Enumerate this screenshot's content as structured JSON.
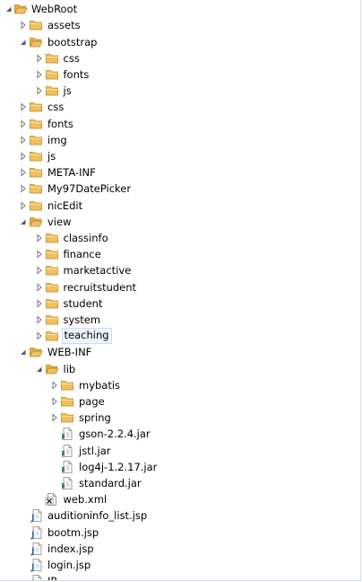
{
  "tree": [
    {
      "label": "WebRoot",
      "type": "folder",
      "depth": 0,
      "expanded": true
    },
    {
      "label": "assets",
      "type": "folder",
      "depth": 1,
      "expanded": false
    },
    {
      "label": "bootstrap",
      "type": "folder",
      "depth": 1,
      "expanded": true
    },
    {
      "label": "css",
      "type": "folder",
      "depth": 2,
      "expanded": false
    },
    {
      "label": "fonts",
      "type": "folder",
      "depth": 2,
      "expanded": false
    },
    {
      "label": "js",
      "type": "folder",
      "depth": 2,
      "expanded": false
    },
    {
      "label": "css",
      "type": "folder",
      "depth": 1,
      "expanded": false
    },
    {
      "label": "fonts",
      "type": "folder",
      "depth": 1,
      "expanded": false
    },
    {
      "label": "img",
      "type": "folder",
      "depth": 1,
      "expanded": false
    },
    {
      "label": "js",
      "type": "folder",
      "depth": 1,
      "expanded": false
    },
    {
      "label": "META-INF",
      "type": "folder",
      "depth": 1,
      "expanded": false
    },
    {
      "label": "My97DatePicker",
      "type": "folder",
      "depth": 1,
      "expanded": false
    },
    {
      "label": "nicEdit",
      "type": "folder",
      "depth": 1,
      "expanded": false
    },
    {
      "label": "view",
      "type": "folder",
      "depth": 1,
      "expanded": true
    },
    {
      "label": "classinfo",
      "type": "folder",
      "depth": 2,
      "expanded": false
    },
    {
      "label": "finance",
      "type": "folder",
      "depth": 2,
      "expanded": false
    },
    {
      "label": "marketactive",
      "type": "folder",
      "depth": 2,
      "expanded": false
    },
    {
      "label": "recruitstudent",
      "type": "folder",
      "depth": 2,
      "expanded": false
    },
    {
      "label": "student",
      "type": "folder",
      "depth": 2,
      "expanded": false
    },
    {
      "label": "system",
      "type": "folder",
      "depth": 2,
      "expanded": false
    },
    {
      "label": "teaching",
      "type": "folder",
      "depth": 2,
      "expanded": false,
      "selected": true
    },
    {
      "label": "WEB-INF",
      "type": "folder",
      "depth": 1,
      "expanded": true
    },
    {
      "label": "lib",
      "type": "folder",
      "depth": 2,
      "expanded": true
    },
    {
      "label": "mybatis",
      "type": "folder",
      "depth": 3,
      "expanded": false
    },
    {
      "label": "page",
      "type": "folder",
      "depth": 3,
      "expanded": false
    },
    {
      "label": "spring",
      "type": "folder",
      "depth": 3,
      "expanded": false
    },
    {
      "label": "gson-2.2.4.jar",
      "type": "jar",
      "depth": 3
    },
    {
      "label": "jstl.jar",
      "type": "jar",
      "depth": 3
    },
    {
      "label": "log4j-1.2.17.jar",
      "type": "jar",
      "depth": 3
    },
    {
      "label": "standard.jar",
      "type": "jar",
      "depth": 3
    },
    {
      "label": "web.xml",
      "type": "xml",
      "depth": 2
    },
    {
      "label": "auditioninfo_list.jsp",
      "type": "jsp",
      "depth": 1
    },
    {
      "label": "bootm.jsp",
      "type": "jsp",
      "depth": 1
    },
    {
      "label": "index.jsp",
      "type": "jsp",
      "depth": 1
    },
    {
      "label": "login.jsp",
      "type": "jsp",
      "depth": 1
    },
    {
      "label": "IP",
      "type": "jsp",
      "depth": 1,
      "cut": true
    }
  ],
  "colors": {
    "folder_fill": "#f2c05c",
    "folder_stroke": "#b8862a",
    "arrow": "#7a7a7a",
    "selection_bg": "#eef6fd",
    "selection_border": "#c5ddf3"
  },
  "icons": {
    "folder": "folder-icon",
    "jar": "jar-file-icon",
    "xml": "xml-file-icon",
    "jsp": "jsp-file-icon",
    "arrow_collapsed": "expand-arrow-icon",
    "arrow_expanded": "collapse-arrow-icon"
  }
}
